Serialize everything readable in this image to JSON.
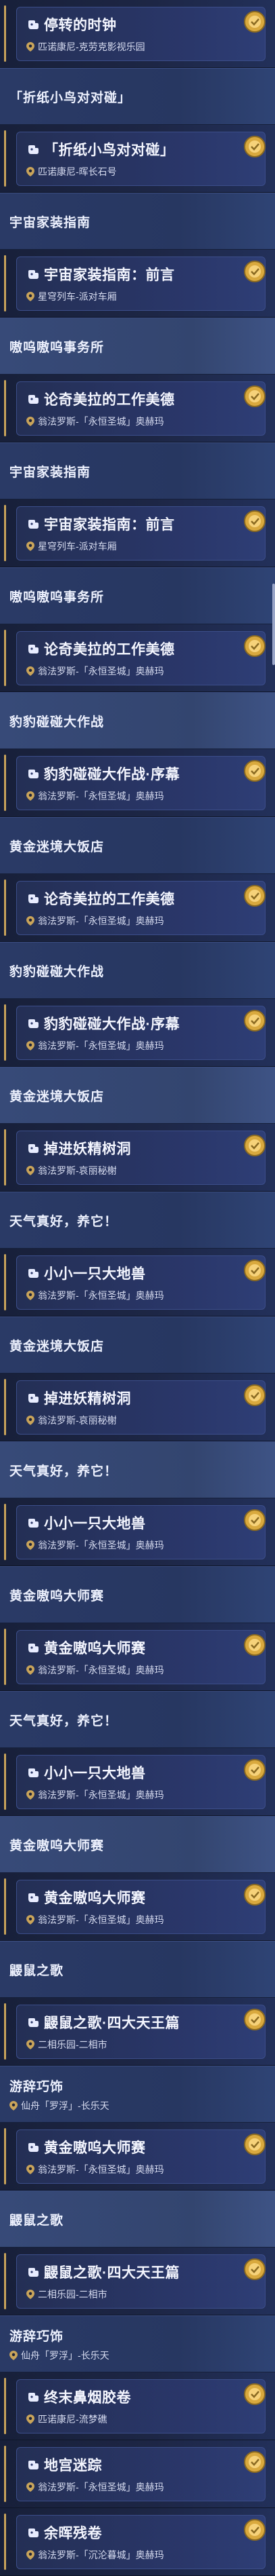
{
  "items": [
    {
      "type": "card",
      "title": "停转的时钟",
      "location": "匹诺康尼-克劳克影视乐园"
    },
    {
      "type": "header",
      "title": "「折纸小鸟对对碰」"
    },
    {
      "type": "card",
      "title": "「折纸小鸟对对碰」",
      "location": "匹诺康尼-晖长石号"
    },
    {
      "type": "header",
      "title": "宇宙家装指南"
    },
    {
      "type": "card",
      "title": "宇宙家装指南：前言",
      "location": "星穹列车-派对车厢"
    },
    {
      "type": "header",
      "title": "嗷呜嗷呜事务所"
    },
    {
      "type": "card",
      "title": "论奇美拉的工作美德",
      "location": "翁法罗斯-「永恒圣城」奥赫玛"
    },
    {
      "type": "header",
      "title": "宇宙家装指南"
    },
    {
      "type": "card",
      "title": "宇宙家装指南：前言",
      "location": "星穹列车-派对车厢"
    },
    {
      "type": "header",
      "title": "嗷呜嗷呜事务所"
    },
    {
      "type": "card",
      "title": "论奇美拉的工作美德",
      "location": "翁法罗斯-「永恒圣城」奥赫玛"
    },
    {
      "type": "header",
      "title": "豹豹碰碰大作战"
    },
    {
      "type": "card",
      "title": "豹豹碰碰大作战·序幕",
      "location": "翁法罗斯-「永恒圣城」奥赫玛"
    },
    {
      "type": "header",
      "title": "黄金迷境大饭店"
    },
    {
      "type": "card",
      "title": "论奇美拉的工作美德",
      "location": "翁法罗斯-「永恒圣城」奥赫玛"
    },
    {
      "type": "header",
      "title": "豹豹碰碰大作战"
    },
    {
      "type": "card",
      "title": "豹豹碰碰大作战·序幕",
      "location": "翁法罗斯-「永恒圣城」奥赫玛"
    },
    {
      "type": "header",
      "title": "黄金迷境大饭店"
    },
    {
      "type": "card",
      "title": "掉进妖精树洞",
      "location": "翁法罗斯-哀丽秘榭"
    },
    {
      "type": "header",
      "title": "天气真好，养它！"
    },
    {
      "type": "card",
      "title": "小小一只大地兽",
      "location": "翁法罗斯-「永恒圣城」奥赫玛"
    },
    {
      "type": "header",
      "title": "黄金迷境大饭店"
    },
    {
      "type": "card",
      "title": "掉进妖精树洞",
      "location": "翁法罗斯-哀丽秘榭"
    },
    {
      "type": "header",
      "title": "天气真好，养它！"
    },
    {
      "type": "card",
      "title": "小小一只大地兽",
      "location": "翁法罗斯-「永恒圣城」奥赫玛"
    },
    {
      "type": "header",
      "title": "黄金嗷呜大师赛"
    },
    {
      "type": "card",
      "title": "黄金嗷呜大师赛",
      "location": "翁法罗斯-「永恒圣城」奥赫玛"
    },
    {
      "type": "header",
      "title": "天气真好，养它！"
    },
    {
      "type": "card",
      "title": "小小一只大地兽",
      "location": "翁法罗斯-「永恒圣城」奥赫玛"
    },
    {
      "type": "header",
      "title": "黄金嗷呜大师赛"
    },
    {
      "type": "card",
      "title": "黄金嗷呜大师赛",
      "location": "翁法罗斯-「永恒圣城」奥赫玛"
    },
    {
      "type": "header",
      "title": "鼹鼠之歌"
    },
    {
      "type": "card",
      "title": "鼹鼠之歌·四大天王篇",
      "location": "二相乐园-二相市"
    },
    {
      "type": "header",
      "title": "游辞巧饰"
    },
    {
      "type": "card",
      "title": "黄金嗷呜大师赛",
      "location": "翁法罗斯-「永恒圣城」奥赫玛"
    },
    {
      "type": "header",
      "title": "鼹鼠之歌"
    },
    {
      "type": "card",
      "title": "鼹鼠之歌·四大天王篇",
      "location": "二相乐园-二相市"
    },
    {
      "type": "header",
      "title": "游辞巧饰"
    },
    {
      "type": "card",
      "title": "终末鼻烟胶卷",
      "location": "匹诺康尼-流梦礁"
    },
    {
      "type": "card",
      "title": "地宫迷踪",
      "location": "翁法罗斯-「永恒圣城」奥赫玛"
    },
    {
      "type": "card",
      "title": "余晖残卷",
      "location": "翁法罗斯-「沉沦暮城」奥赫玛"
    }
  ],
  "subtitles": {
    "游辞巧饰_1": "仙舟「罗浮」-长乐天",
    "游辞巧饰_2": "仙舟「罗浮」-长乐天"
  },
  "icons": {
    "quest": "quest-hand-icon",
    "location": "location-pin-icon",
    "badge": "gold-coin-badge-icon"
  },
  "colors": {
    "accent": "#c9a45a",
    "background": "#1c2238",
    "header": "#2a3a66",
    "card": "#242f55"
  }
}
